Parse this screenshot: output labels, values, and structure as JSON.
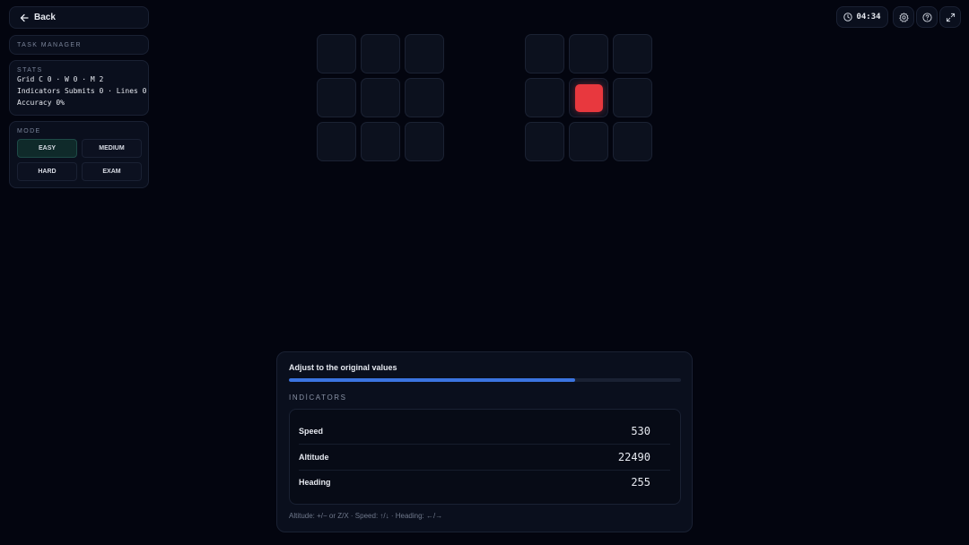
{
  "nav": {
    "back_label": "Back"
  },
  "sidebar": {
    "title": "TASK MANAGER",
    "stats": {
      "heading": "STATS",
      "line1": "Grid C 0 · W 0 · M 2",
      "line2": "Indicators Submits 0 · Lines 0",
      "line3": "Accuracy 0%"
    },
    "mode": {
      "heading": "MODE",
      "options": [
        "EASY",
        "MEDIUM",
        "HARD",
        "EXAM"
      ],
      "selected": "EASY"
    }
  },
  "topbar": {
    "timer": "04:34",
    "icons": [
      "clock-icon",
      "gear-icon",
      "help-icon",
      "fullscreen-icon"
    ]
  },
  "grids": {
    "left": {
      "lit_cells": []
    },
    "right": {
      "lit_cells": [
        4
      ]
    },
    "lit_color": "#e8383e"
  },
  "indicators_panel": {
    "title": "Adjust to the original values",
    "progress": 0.73,
    "section_label": "INDİCATORS",
    "rows": [
      {
        "label": "Speed",
        "value": "530"
      },
      {
        "label": "Altitude",
        "value": "22490"
      },
      {
        "label": "Heading",
        "value": "255"
      }
    ],
    "hint": "Altitude: +/− or Z/X · Speed: ↑/↓ · Heading: ←/→"
  },
  "colors": {
    "background": "#03050f",
    "accent_blue": "#3b74e0",
    "active_mode": "#0f2a2a"
  }
}
